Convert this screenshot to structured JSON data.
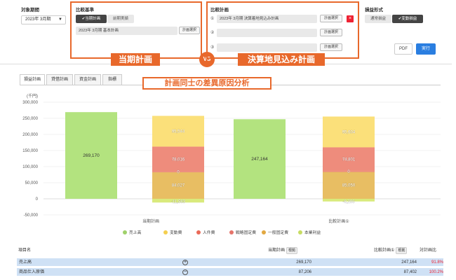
{
  "filters": {
    "period": {
      "label": "対象期間",
      "value": "2023年 3月期"
    },
    "base": {
      "label": "比較基準",
      "options": [
        "当期計画",
        "前期実績"
      ],
      "selected_option": "当期計画",
      "plan": "2023年 3月期 基本計画",
      "plan_select_label": "計画選択",
      "callout": "当期計画"
    },
    "vs_label": "VS",
    "compare": {
      "label": "比較計画",
      "rows": [
        {
          "num": "①",
          "value": "2023年 3月期 決算着地見込み計画",
          "button": "計画選択"
        },
        {
          "num": "②",
          "value": "",
          "button": "計画選択"
        },
        {
          "num": "③",
          "value": "",
          "button": "計画選択"
        }
      ],
      "remove_icon": "×",
      "callout": "決算地見込み計画"
    },
    "pl_format": {
      "label": "損益形式",
      "options": [
        "通常損益",
        "変動損益"
      ],
      "selected_option": "変動損益"
    },
    "pdf_button": "PDF",
    "run_button": "実行"
  },
  "tabs": [
    "損益計画",
    "貸借計画",
    "資金計画",
    "指標"
  ],
  "active_tab": "損益計画",
  "analysis_callout": "計画同士の差異原因分析",
  "chart_data": {
    "type": "bar",
    "stacked": true,
    "unit_label": "(千円)",
    "categories": [
      "当期計画",
      "比較計画①"
    ],
    "ylim": [
      -50000,
      300000
    ],
    "yticks": [
      -50000,
      0,
      50000,
      100000,
      150000,
      200000,
      250000,
      300000
    ],
    "ytick_labels": [
      "-50,000",
      "0",
      "50,000",
      "100,000",
      "150,000",
      "200,000",
      "250,000",
      "300,000"
    ],
    "grid": true,
    "legend_position": "bottom",
    "revenue": {
      "name": "売上高",
      "color": "#b3e37f",
      "values": [
        269170,
        247164
      ],
      "labels": [
        "269,170",
        "247,164"
      ]
    },
    "cost_stack": [
      {
        "name": "本業利益",
        "color": "#d9ea7c",
        "values": [
          -11583,
          -8290
        ],
        "labels": [
          "-11,583",
          "-8,290"
        ]
      },
      {
        "name": "一般固定費",
        "color": "#e8be63",
        "values": [
          84027,
          85050
        ],
        "labels": [
          "84,027",
          "85,050"
        ]
      },
      {
        "name": "戦略固定費",
        "color": "#e8857a",
        "values": [
          0,
          0
        ],
        "labels": [
          "0",
          "0"
        ]
      },
      {
        "name": "人件費",
        "color": "#ee8c7c",
        "values": [
          78016,
          74801
        ],
        "labels": [
          "78,016",
          "74,801"
        ]
      },
      {
        "name": "変動費",
        "color": "#fbe07a",
        "values": [
          95544,
          95604
        ],
        "labels": [
          "95,544",
          "95,604"
        ]
      }
    ],
    "legend": [
      {
        "name": "売上高",
        "color": "#9fd16a"
      },
      {
        "name": "変動費",
        "color": "#f4cf4f"
      },
      {
        "name": "人件費",
        "color": "#ea6a58"
      },
      {
        "name": "戦略固定費",
        "color": "#e5746a"
      },
      {
        "name": "一般固定費",
        "color": "#e2a842"
      },
      {
        "name": "本業利益",
        "color": "#c7dc63"
      }
    ]
  },
  "table": {
    "headers": {
      "item": "項目名",
      "base": "当期計画",
      "base_badge": "根拠",
      "compare": "比較計画①",
      "compare_badge": "根拠",
      "ratio": "対計画比"
    },
    "rows": [
      {
        "item": "売上高",
        "toggle": "+",
        "base": "269,170",
        "compare": "247,164",
        "ratio": "91.8%"
      },
      {
        "item": "商品仕入原価",
        "toggle": "−",
        "base": "87,206",
        "compare": "87,402",
        "ratio": "100.2%"
      }
    ]
  }
}
